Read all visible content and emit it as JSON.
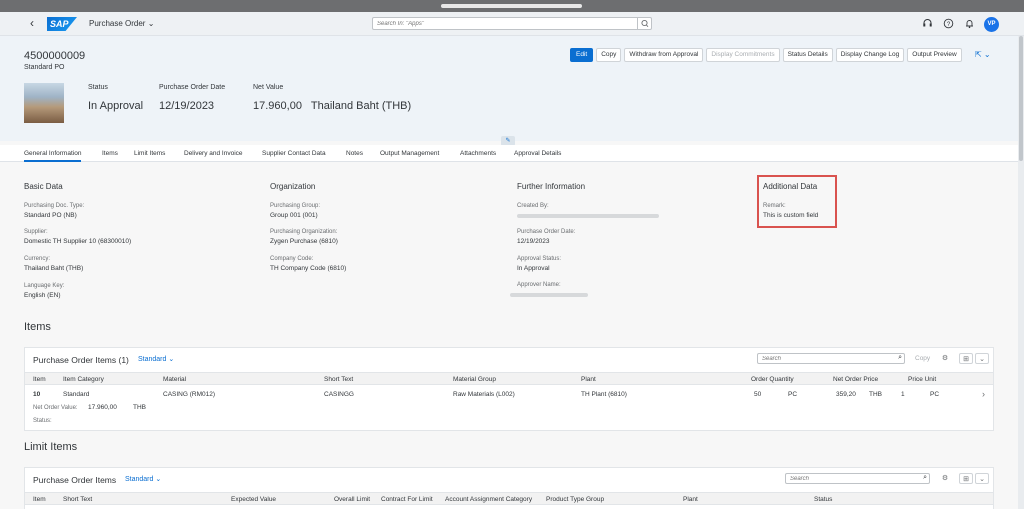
{
  "shell": {
    "app_title": "Purchase Order",
    "search_placeholder": "Search In: \"Apps\"",
    "avatar_initials": "VP",
    "brand": "SAP"
  },
  "header": {
    "po_number": "4500000009",
    "po_type": "Standard PO",
    "kpis": [
      {
        "label": "Status",
        "value": "In Approval"
      },
      {
        "label": "Purchase Order Date",
        "value": "12/19/2023"
      },
      {
        "label": "Net Value",
        "value": "17.960,00   Thailand Baht (THB)"
      }
    ],
    "actions": [
      "Edit",
      "Copy",
      "Withdraw from Approval",
      "Display Commitments",
      "Status Details",
      "Display Change Log",
      "Output Preview"
    ]
  },
  "tabs": [
    "General Information",
    "Items",
    "Limit Items",
    "Delivery and Invoice",
    "Supplier Contact Data",
    "Notes",
    "Output Management",
    "Attachments",
    "Approval Details"
  ],
  "general": {
    "basic": {
      "title": "Basic Data",
      "fields": [
        {
          "label": "Purchasing Doc. Type:",
          "value": "Standard PO (NB)"
        },
        {
          "label": "Supplier:",
          "value": "Domestic TH Supplier 10 (68300010)"
        },
        {
          "label": "Currency:",
          "value": "Thailand Baht (THB)"
        },
        {
          "label": "Language Key:",
          "value": "English (EN)"
        }
      ]
    },
    "org": {
      "title": "Organization",
      "fields": [
        {
          "label": "Purchasing Group:",
          "value": "Group 001 (001)"
        },
        {
          "label": "Purchasing Organization:",
          "value": "Zygen Purchase (6810)"
        },
        {
          "label": "Company Code:",
          "value": "TH Company Code (6810)"
        }
      ]
    },
    "further": {
      "title": "Further Information",
      "fields": [
        {
          "label": "Created By:",
          "value": ""
        },
        {
          "label": "Purchase Order Date:",
          "value": "12/19/2023"
        },
        {
          "label": "Approval Status:",
          "value": "In Approval"
        },
        {
          "label": "Approver Name:",
          "value": ""
        }
      ]
    },
    "additional": {
      "title": "Additional Data",
      "fields": [
        {
          "label": "Remark:",
          "value": "This is custom field"
        }
      ]
    }
  },
  "items_section": {
    "heading": "Items",
    "table_title": "Purchase Order Items (1)",
    "variant": "Standard",
    "search_placeholder": "Search",
    "copy_label": "Copy",
    "columns": [
      "Item",
      "Item Category",
      "Material",
      "Short Text",
      "Material Group",
      "Plant",
      "Order Quantity",
      "Net Order Price",
      "Price Unit"
    ],
    "rows": [
      {
        "item": "10",
        "category": "Standard",
        "material": "CASING (RM012)",
        "short_text": "CASINGG",
        "material_group": "Raw Materials (L002)",
        "plant": "TH Plant (6810)",
        "qty": "50",
        "qty_unit": "PC",
        "price": "359,20",
        "price_cur": "THB",
        "price_unit": "1",
        "price_unit_uom": "PC",
        "net_value_label": "Net Order Value:",
        "net_value": "17.960,00",
        "net_value_cur": "THB",
        "status_label": "Status:"
      }
    ]
  },
  "limit_section": {
    "heading": "Limit Items",
    "table_title": "Purchase Order Items",
    "variant": "Standard",
    "search_placeholder": "Search",
    "columns": [
      "Item",
      "Short Text",
      "Expected Value",
      "Overall Limit",
      "Contract For Limit",
      "Account Assignment Category",
      "Product Type Group",
      "Plant",
      "Status"
    ]
  }
}
